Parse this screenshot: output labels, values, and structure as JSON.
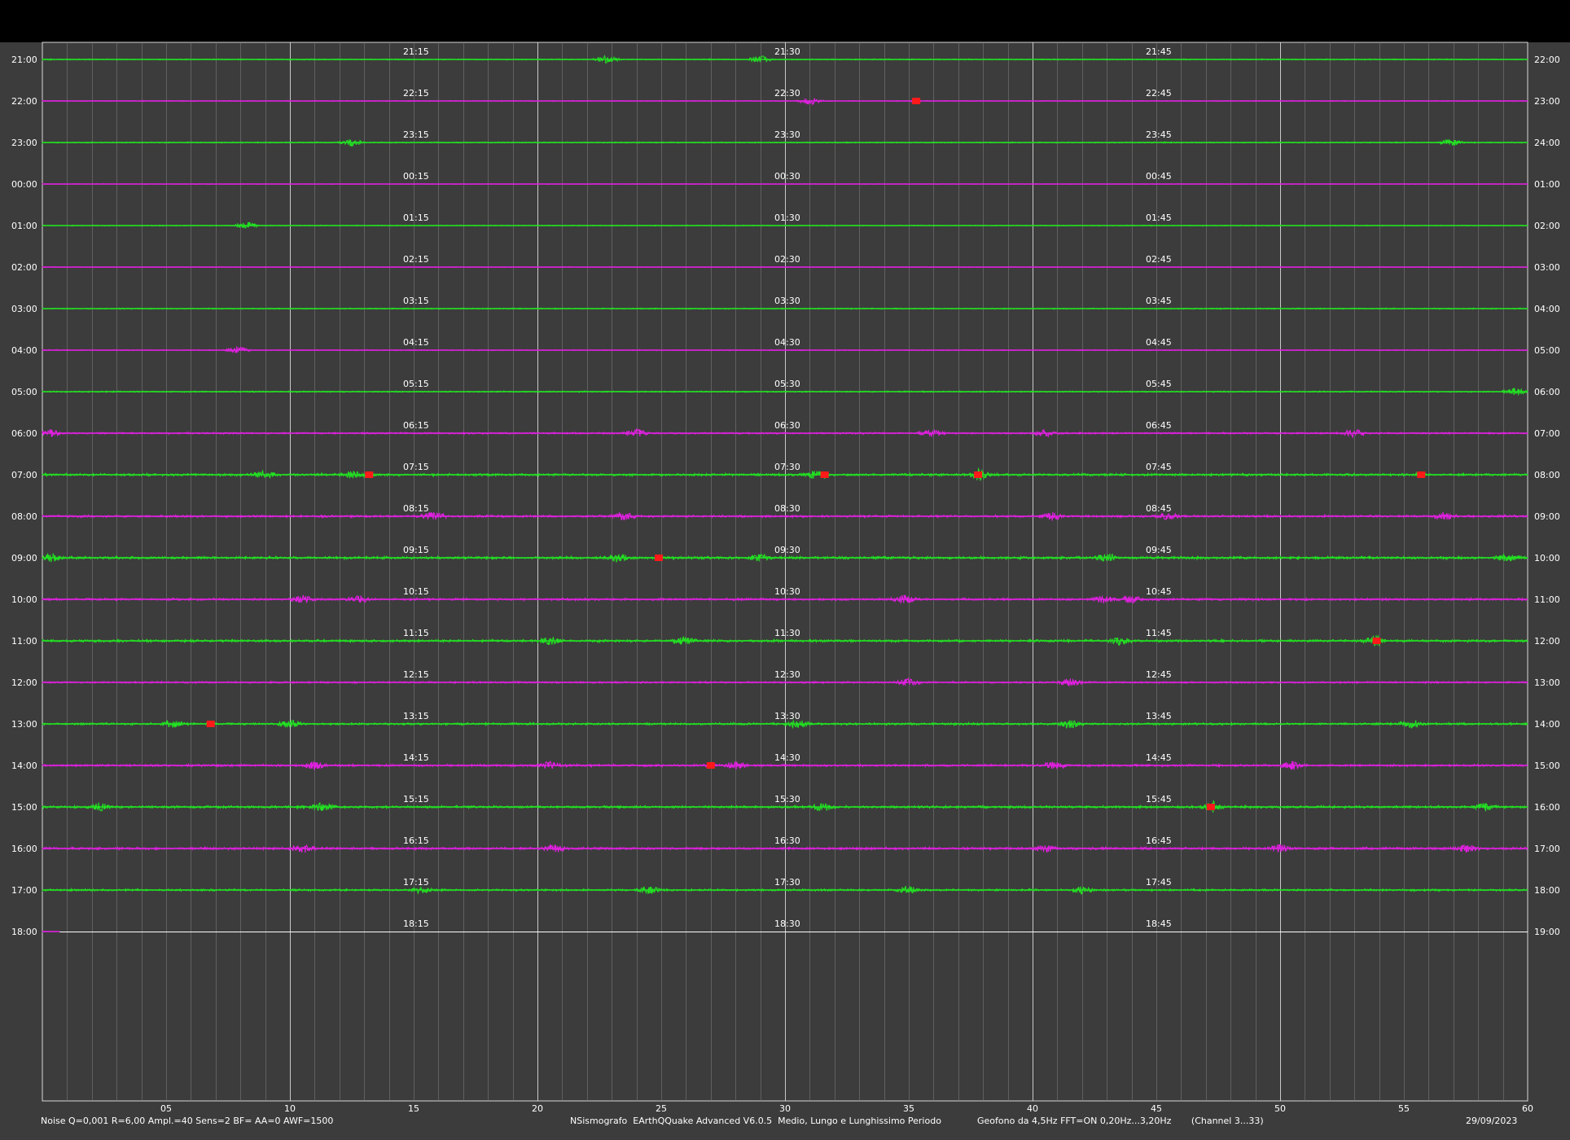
{
  "chart_data": {
    "type": "line",
    "minutes_per_row": 60,
    "x_ticks": [
      "05",
      "10",
      "15",
      "20",
      "25",
      "30",
      "35",
      "40",
      "45",
      "50",
      "55",
      "60"
    ],
    "xlim": [
      0,
      60
    ],
    "grid": true,
    "colors": {
      "background": "#3c3c3c",
      "top_bar": "#000000",
      "odd_trace": "#22e022",
      "even_trace": "#e020e0",
      "event": "#ff1a1a",
      "grid_major": "#d8d8d8",
      "grid_minor": "#7a7a7a",
      "text": "#ffffff"
    },
    "rows": [
      {
        "left": "21:00",
        "right": "22:00",
        "q1": "21:15",
        "q2": "21:30",
        "q3": "21:45",
        "trace": "green",
        "noise": 0.5,
        "bursts": [
          22.8,
          29.0
        ],
        "events": []
      },
      {
        "left": "22:00",
        "right": "23:00",
        "q1": "22:15",
        "q2": "22:30",
        "q3": "22:45",
        "trace": "magenta",
        "noise": 0.4,
        "bursts": [
          31.0
        ],
        "events": [
          35.3
        ]
      },
      {
        "left": "23:00",
        "right": "24:00",
        "q1": "23:15",
        "q2": "23:30",
        "q3": "23:45",
        "trace": "green",
        "noise": 0.5,
        "bursts": [
          12.5,
          56.9
        ],
        "events": []
      },
      {
        "left": "00:00",
        "right": "01:00",
        "q1": "00:15",
        "q2": "00:30",
        "q3": "00:45",
        "trace": "magenta",
        "noise": 0.3,
        "bursts": [],
        "events": []
      },
      {
        "left": "01:00",
        "right": "02:00",
        "q1": "01:15",
        "q2": "01:30",
        "q3": "01:45",
        "trace": "green",
        "noise": 0.4,
        "bursts": [
          8.3
        ],
        "events": []
      },
      {
        "left": "02:00",
        "right": "03:00",
        "q1": "02:15",
        "q2": "02:30",
        "q3": "02:45",
        "trace": "magenta",
        "noise": 0.3,
        "bursts": [],
        "events": []
      },
      {
        "left": "03:00",
        "right": "04:00",
        "q1": "03:15",
        "q2": "03:30",
        "q3": "03:45",
        "trace": "green",
        "noise": 0.5,
        "bursts": [],
        "events": []
      },
      {
        "left": "04:00",
        "right": "05:00",
        "q1": "04:15",
        "q2": "04:30",
        "q3": "04:45",
        "trace": "magenta",
        "noise": 0.4,
        "bursts": [
          7.9
        ],
        "events": []
      },
      {
        "left": "05:00",
        "right": "06:00",
        "q1": "05:15",
        "q2": "05:30",
        "q3": "05:45",
        "trace": "green",
        "noise": 0.6,
        "bursts": [
          59.5
        ],
        "events": []
      },
      {
        "left": "06:00",
        "right": "07:00",
        "q1": "06:15",
        "q2": "06:30",
        "q3": "06:45",
        "trace": "magenta",
        "noise": 0.8,
        "bursts": [
          0.3,
          24.0,
          35.9,
          40.5,
          53.0
        ],
        "events": []
      },
      {
        "left": "07:00",
        "right": "08:00",
        "q1": "07:15",
        "q2": "07:30",
        "q3": "07:45",
        "trace": "green",
        "noise": 1.1,
        "bursts": [
          9.0,
          12.5,
          31.2,
          37.9
        ],
        "events": [
          13.2,
          31.6,
          37.8,
          55.7
        ]
      },
      {
        "left": "08:00",
        "right": "09:00",
        "q1": "08:15",
        "q2": "08:30",
        "q3": "08:45",
        "trace": "magenta",
        "noise": 1.0,
        "bursts": [
          15.8,
          23.5,
          40.8,
          45.5,
          56.6
        ],
        "events": []
      },
      {
        "left": "09:00",
        "right": "10:00",
        "q1": "09:15",
        "q2": "09:30",
        "q3": "09:45",
        "trace": "green",
        "noise": 1.2,
        "bursts": [
          0.3,
          23.2,
          29.0,
          43.0,
          59.2
        ],
        "events": [
          24.9
        ]
      },
      {
        "left": "10:00",
        "right": "11:00",
        "q1": "10:15",
        "q2": "10:30",
        "q3": "10:45",
        "trace": "magenta",
        "noise": 1.0,
        "bursts": [
          10.5,
          12.8,
          34.8,
          42.9,
          44.0
        ],
        "events": []
      },
      {
        "left": "11:00",
        "right": "12:00",
        "q1": "11:15",
        "q2": "11:30",
        "q3": "11:45",
        "trace": "green",
        "noise": 1.1,
        "bursts": [
          20.5,
          25.9,
          43.5,
          53.8
        ],
        "events": [
          53.9
        ]
      },
      {
        "left": "12:00",
        "right": "13:00",
        "q1": "12:15",
        "q2": "12:30",
        "q3": "12:45",
        "trace": "magenta",
        "noise": 0.8,
        "bursts": [
          35.0,
          41.5
        ],
        "events": []
      },
      {
        "left": "13:00",
        "right": "14:00",
        "q1": "13:15",
        "q2": "13:30",
        "q3": "13:45",
        "trace": "green",
        "noise": 1.0,
        "bursts": [
          5.3,
          10.0,
          30.5,
          41.5,
          55.3
        ],
        "events": [
          6.8
        ]
      },
      {
        "left": "14:00",
        "right": "15:00",
        "q1": "14:15",
        "q2": "14:30",
        "q3": "14:45",
        "trace": "magenta",
        "noise": 1.0,
        "bursts": [
          11.0,
          20.5,
          28.0,
          40.9,
          50.5
        ],
        "events": [
          27.0
        ]
      },
      {
        "left": "15:00",
        "right": "16:00",
        "q1": "15:15",
        "q2": "15:30",
        "q3": "15:45",
        "trace": "green",
        "noise": 1.1,
        "bursts": [
          2.3,
          11.3,
          31.5,
          47.3,
          58.3
        ],
        "events": [
          47.2
        ]
      },
      {
        "left": "16:00",
        "right": "17:00",
        "q1": "16:15",
        "q2": "16:30",
        "q3": "16:45",
        "trace": "magenta",
        "noise": 1.1,
        "bursts": [
          10.5,
          20.7,
          40.5,
          50.0,
          57.5
        ],
        "events": []
      },
      {
        "left": "17:00",
        "right": "18:00",
        "q1": "17:15",
        "q2": "17:30",
        "q3": "17:45",
        "trace": "green",
        "noise": 0.9,
        "bursts": [
          15.3,
          24.5,
          35.0,
          42.0
        ],
        "events": []
      },
      {
        "left": "18:00",
        "right": "19:00",
        "q1": "18:15",
        "q2": "18:30",
        "q3": "18:45",
        "trace": "magenta",
        "noise": 0.3,
        "bursts": [],
        "events": [],
        "end": 0.7
      }
    ]
  },
  "footer": {
    "left": "Noise Q=0,001 R=6,00 Ampl.=40 Sens=2 BF= AA=0 AWF=1500",
    "center": "NSismografo  EArthQQuake Advanced V6.0.5  Medio, Lungo e Lunghissimo Periodo",
    "right": "Geofono da 4,5Hz FFT=ON 0,20Hz...3,20Hz       (Channel 3...33)",
    "date": "29/09/2023"
  }
}
